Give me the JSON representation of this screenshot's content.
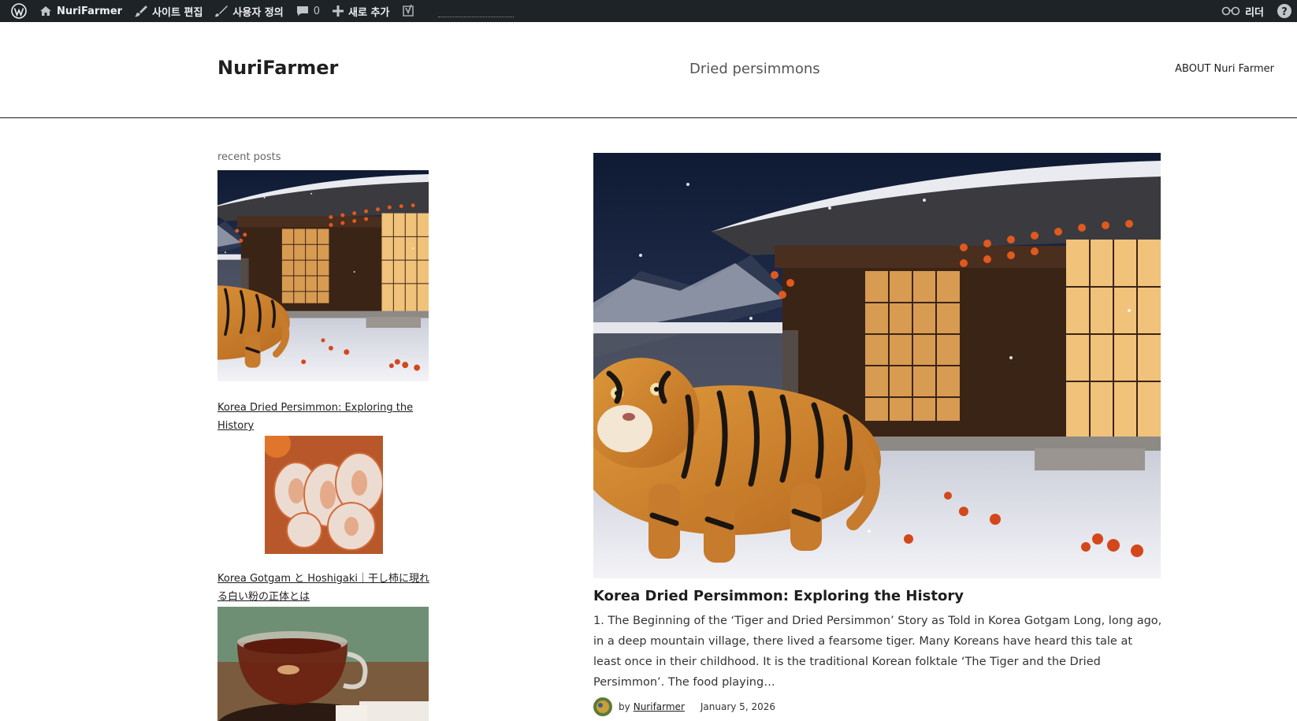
{
  "admin_bar": {
    "site_name": "NuriFarmer",
    "edit_site": "사이트 편집",
    "customize": "사용자 정의",
    "comments_count": "0",
    "new": "새로 추가",
    "reader": "리더",
    "help_icon": "help-icon"
  },
  "header": {
    "site_title": "NuriFarmer",
    "tagline": "Dried persimmons",
    "nav": {
      "about": "ABOUT Nuri Farmer"
    }
  },
  "sidebar": {
    "widget_title": "recent posts",
    "posts": [
      {
        "title": "Korea Dried Persimmon: Exploring the History",
        "image": "tiger-hanok-snow"
      },
      {
        "title": "Korea Gotgam と Hoshigaki｜干し柿に現れる白い粉の正体とは",
        "image": "sugar-dusted-dried-persimmons"
      },
      {
        "title": "",
        "image": "persimmon-tea-cup"
      }
    ]
  },
  "main": {
    "featured_image": "tiger-hanok-snow",
    "post_title": "Korea Dried Persimmon: Exploring the History",
    "excerpt": "1. The Beginning of the ‘Tiger and Dried Persimmon’ Story as Told in Korea Gotgam Long, long ago, in a deep mountain village, there lived a fearsome tiger. Many Koreans have heard this tale at least once in their childhood. It is the traditional Korean folktale ‘The Tiger and the Dried Persimmon’. The food playing…",
    "meta": {
      "by": "by",
      "author": "Nurifarmer",
      "date": "January 5, 2026"
    }
  },
  "colors": {
    "admin_bar_bg": "#1d2327",
    "text": "#1e1e1e",
    "muted": "#666666"
  }
}
